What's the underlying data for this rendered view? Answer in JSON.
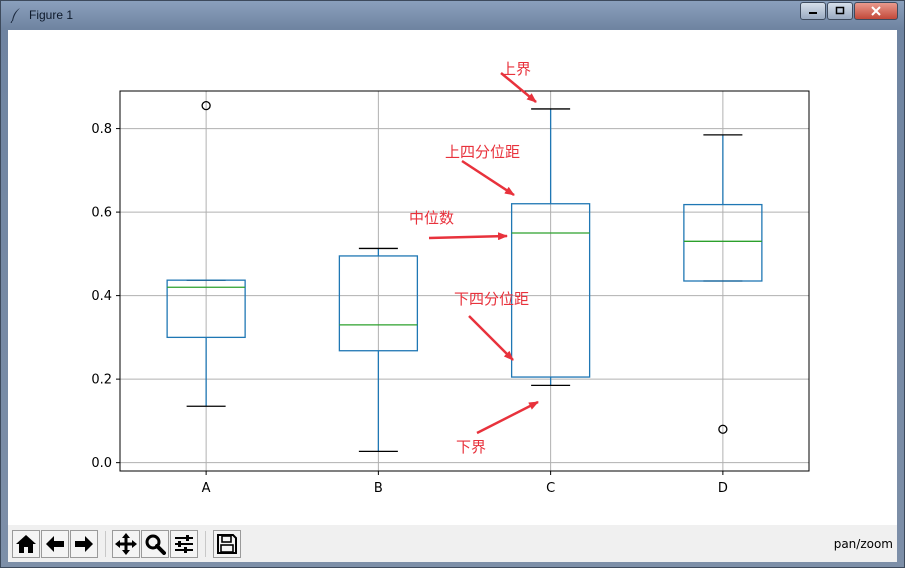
{
  "window": {
    "title": "Figure 1"
  },
  "toolbar": {
    "buttons": [
      "home",
      "back",
      "forward",
      "pan",
      "zoom",
      "configure-subplots",
      "save"
    ],
    "mode_label": "pan/zoom"
  },
  "chart_data": {
    "type": "box",
    "categories": [
      "A",
      "B",
      "C",
      "D"
    ],
    "ylim": [
      -0.02,
      0.89
    ],
    "yticks": [
      0.0,
      0.2,
      0.4,
      0.6,
      0.8
    ],
    "ytick_labels": [
      "0.0",
      "0.2",
      "0.4",
      "0.6",
      "0.8"
    ],
    "grid": true,
    "boxes": [
      {
        "name": "A",
        "whislo": 0.135,
        "q1": 0.3,
        "med": 0.42,
        "q3": 0.437,
        "whishi": 0.437,
        "fliers": [
          0.855
        ]
      },
      {
        "name": "B",
        "whislo": 0.027,
        "q1": 0.268,
        "med": 0.33,
        "q3": 0.495,
        "whishi": 0.513,
        "fliers": []
      },
      {
        "name": "C",
        "whislo": 0.185,
        "q1": 0.205,
        "med": 0.55,
        "q3": 0.62,
        "whishi": 0.847,
        "fliers": []
      },
      {
        "name": "D",
        "whislo": 0.435,
        "q1": 0.435,
        "med": 0.53,
        "q3": 0.618,
        "whishi": 0.785,
        "fliers": [
          0.08
        ]
      }
    ],
    "annotations": [
      "上界",
      "上四分位距",
      "中位数",
      "下四分位距",
      "下界"
    ],
    "colors": {
      "box": "#1f77b4",
      "median": "#2ca02c",
      "whisker": "#000000",
      "annotation": "#e8323c",
      "grid": "#b0b0b0"
    }
  }
}
